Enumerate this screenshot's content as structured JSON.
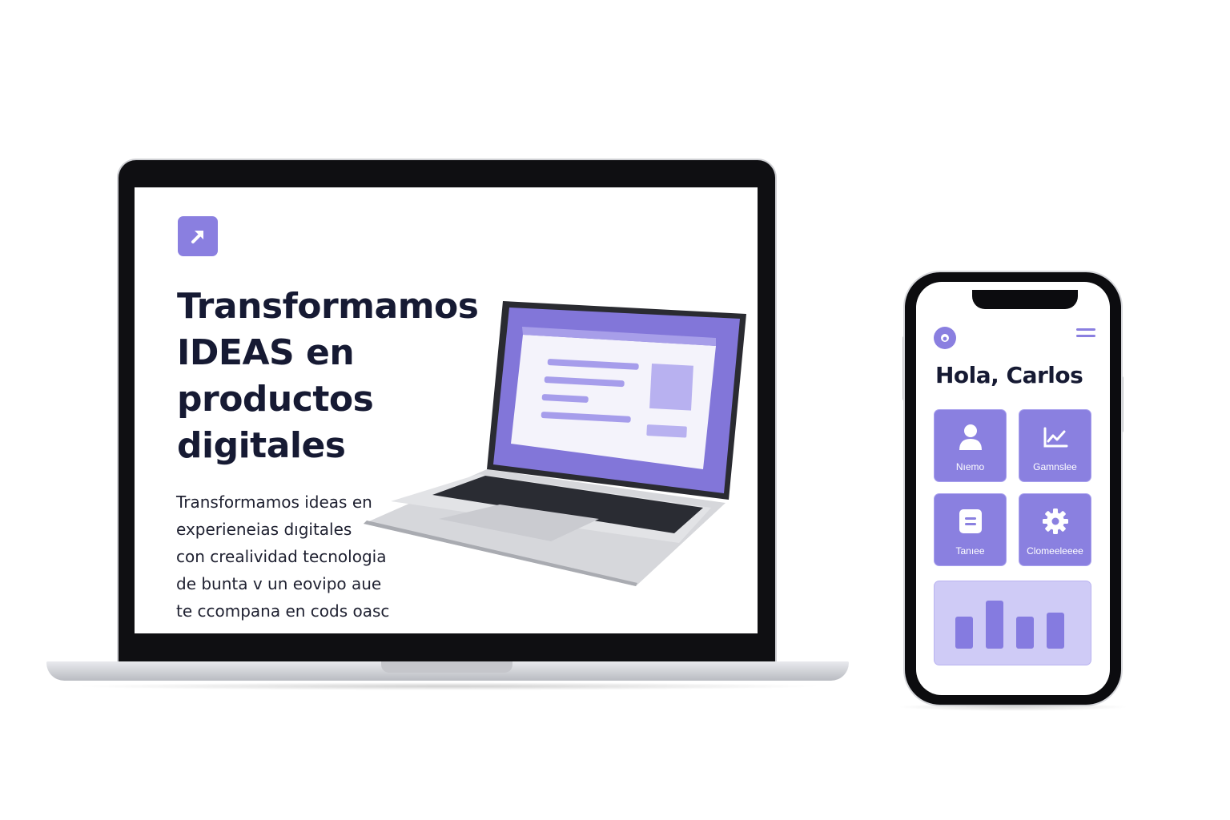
{
  "laptop": {
    "hero_title_lines": [
      "Transformamos",
      "IDEAS en",
      "productos",
      "digitales"
    ],
    "hero_body_lines": [
      "Transformamos ideas en",
      "experieneias dıgitales",
      "con crealividad  tecnologia",
      "de bunta v un eovipo aue",
      "te ccompana en cods oasc"
    ]
  },
  "phone": {
    "greeting": "Hola, Carlos",
    "tiles": [
      {
        "label": "Nıemo",
        "icon": "user-icon"
      },
      {
        "label": "Gamnslee",
        "icon": "chart-line-icon"
      },
      {
        "label": "Tanıee",
        "icon": "document-icon"
      },
      {
        "label": "Clomeeleeee",
        "icon": "gear-icon"
      }
    ],
    "chart_bars": [
      0.57,
      0.86,
      0.57,
      0.64
    ]
  },
  "colors": {
    "accent": "#8a7fe0",
    "accent_light": "#cfcbf6",
    "heading": "#161a33"
  }
}
